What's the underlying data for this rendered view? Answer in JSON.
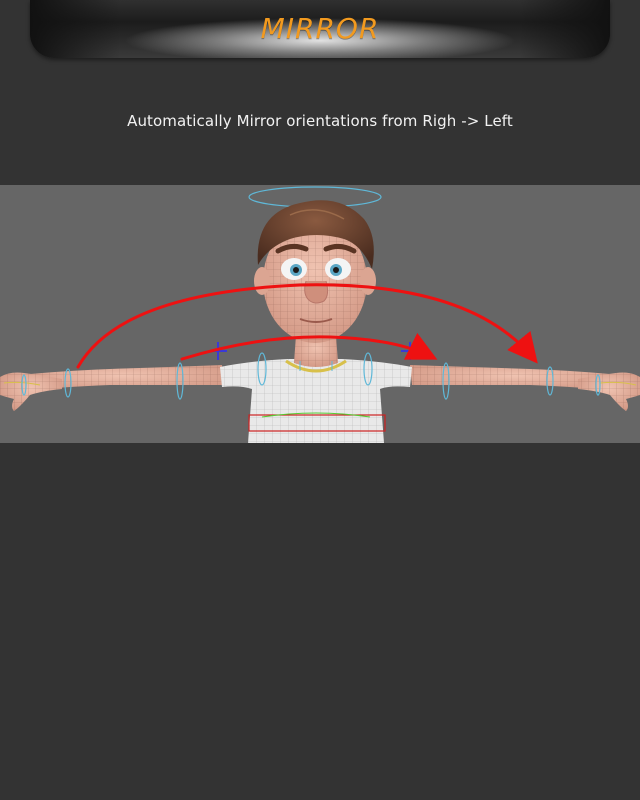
{
  "header": {
    "title": "MIRROR",
    "title_color": "#f29a1f"
  },
  "description": "Automatically Mirror orientations from Righ -> Left",
  "viewport": {
    "background_color": "#666666",
    "arrow_color": "#ee1111",
    "control_color": "#5fb8d8",
    "skin_color": "#e6b1a0",
    "shirt_color": "#e9e9e9",
    "hair_color": "#6a4430"
  }
}
